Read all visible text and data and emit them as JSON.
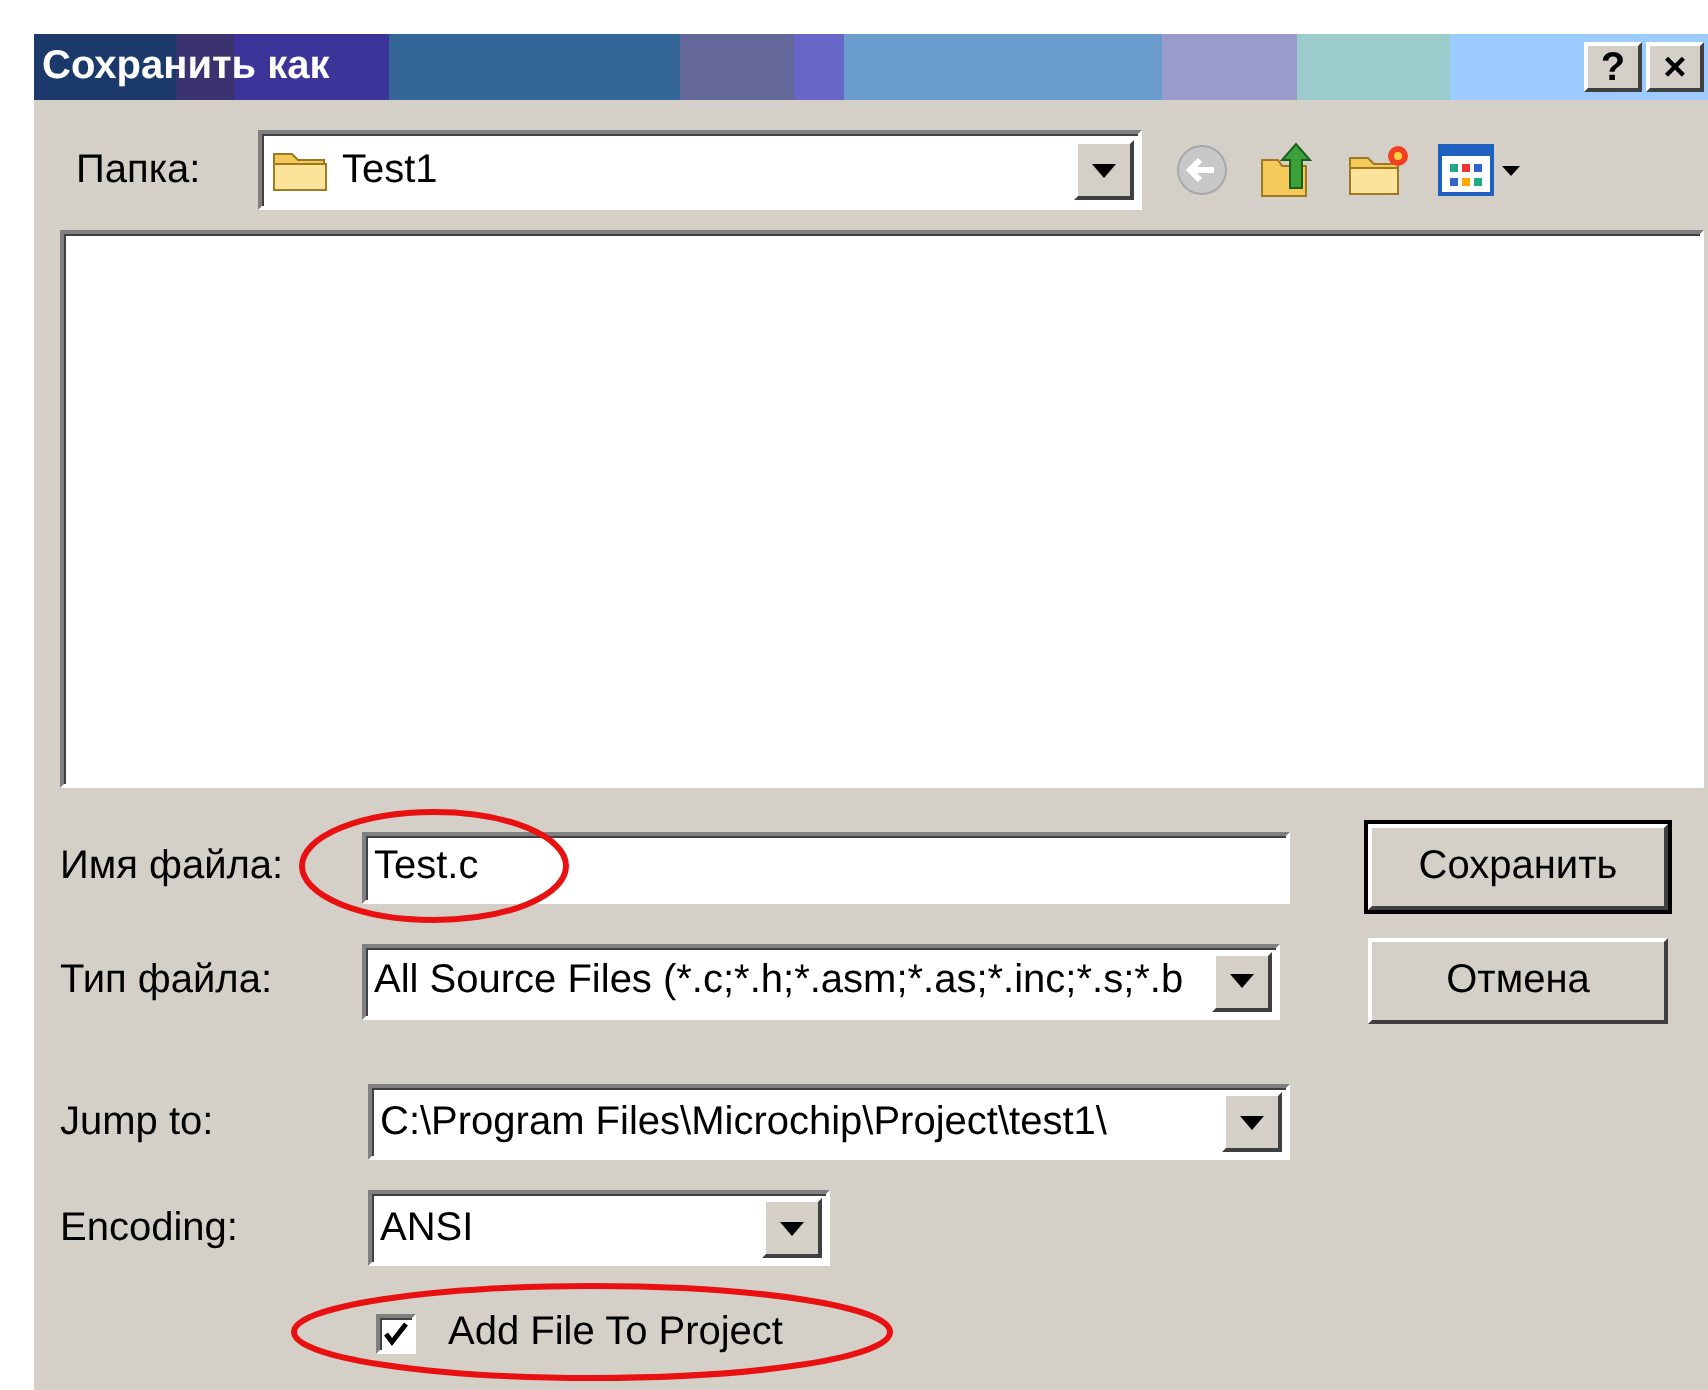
{
  "window": {
    "title": "Сохранить как",
    "help_button": "?",
    "close_button": "×"
  },
  "folder": {
    "label": "Папка:",
    "value": "Test1"
  },
  "file_name": {
    "label": "Имя файла:",
    "value": "Test.c",
    "highlighted": true
  },
  "file_type": {
    "label": "Тип файла:",
    "value": "All Source Files (*.c;*.h;*.asm;*.as;*.inc;*.s;*.b"
  },
  "jump_to": {
    "label": "Jump to:",
    "value": "C:\\Program Files\\Microchip\\Project\\test1\\"
  },
  "encoding": {
    "label": "Encoding:",
    "value": "ANSI"
  },
  "add_to_project": {
    "label": "Add File To Project",
    "checked": true,
    "highlighted": true
  },
  "buttons": [
    {
      "label": "Сохранить",
      "kind": "default"
    },
    {
      "label": "Отмена",
      "kind": "normal"
    }
  ]
}
